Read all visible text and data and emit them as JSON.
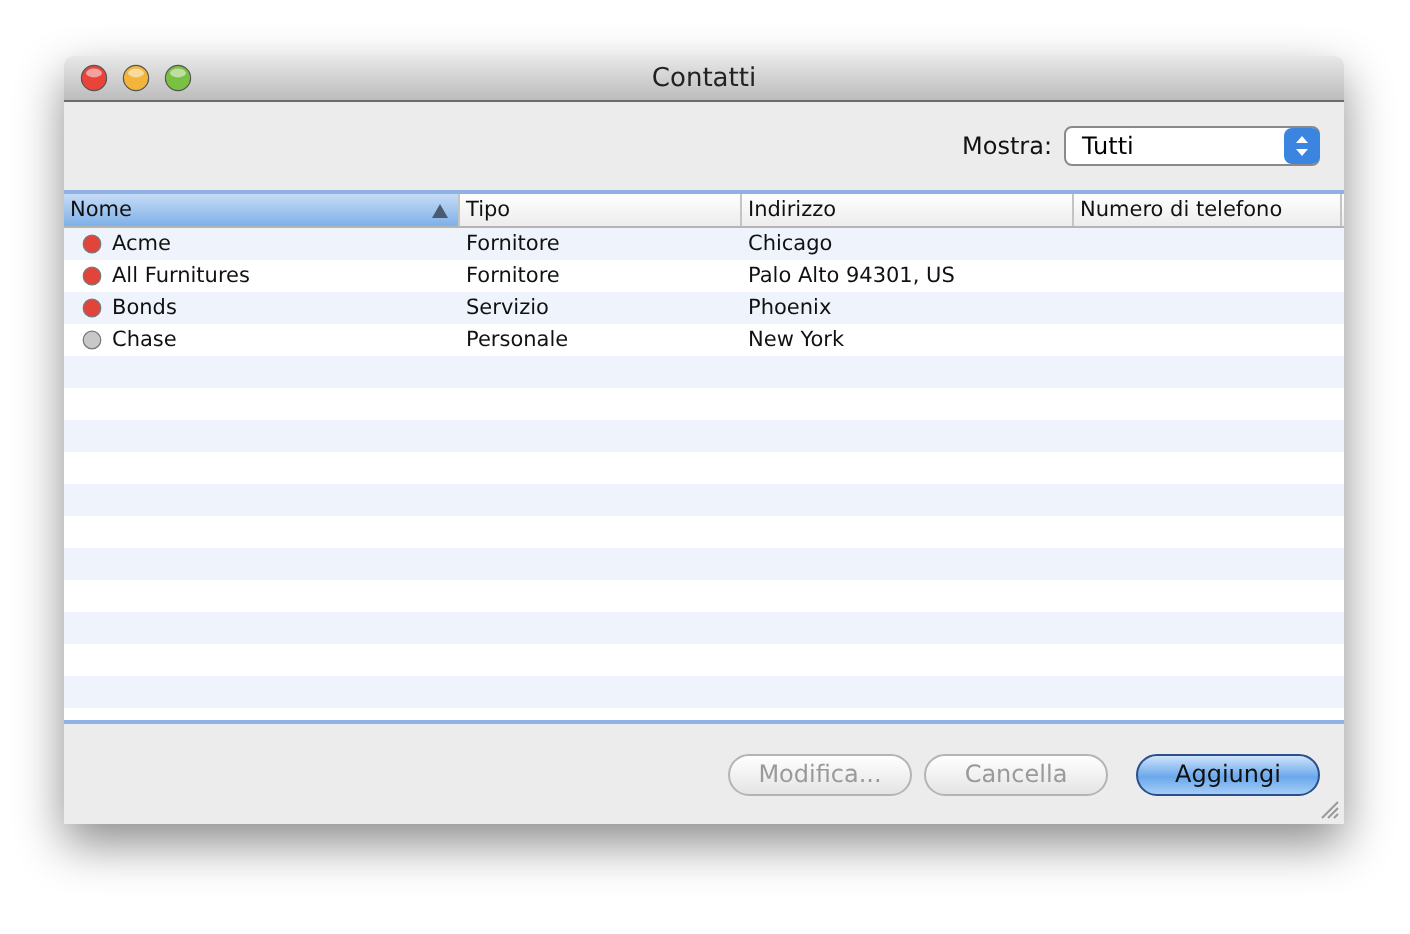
{
  "window": {
    "title": "Contatti"
  },
  "filter": {
    "label": "Mostra:",
    "value": "Tutti"
  },
  "table": {
    "columns": [
      {
        "label": "Nome",
        "selected": true,
        "sorted": true
      },
      {
        "label": "Tipo",
        "selected": false,
        "sorted": false
      },
      {
        "label": "Indirizzo",
        "selected": false,
        "sorted": false
      },
      {
        "label": "Numero di telefono",
        "selected": false,
        "sorted": false
      }
    ],
    "rows": [
      {
        "color": "#e0443a",
        "cells": [
          "Acme",
          "Fornitore",
          "Chicago"
        ]
      },
      {
        "color": "#e0443a",
        "cells": [
          "All Furnitures",
          "Fornitore",
          "Palo Alto 94301, US"
        ]
      },
      {
        "color": "#e0443a",
        "cells": [
          "Bonds",
          "Servizio",
          "Phoenix"
        ]
      },
      {
        "color": "#c8c8c8",
        "cells": [
          "Chase",
          "Personale",
          "New York"
        ]
      }
    ]
  },
  "buttons": [
    {
      "label": "Modifica...",
      "disabled": true,
      "default": false
    },
    {
      "label": "Cancella",
      "disabled": true,
      "default": false
    },
    {
      "label": "Aggiungi",
      "disabled": false,
      "default": true
    }
  ]
}
